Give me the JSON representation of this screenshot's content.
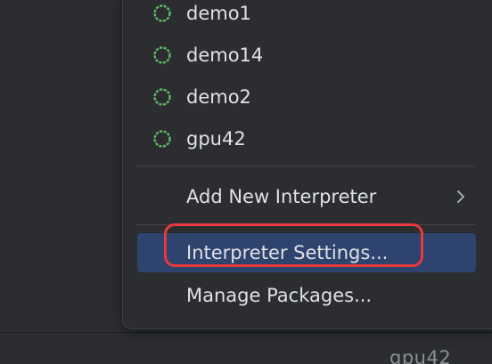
{
  "interpreters": [
    {
      "name": "demo1",
      "icon": "loading-spinner-icon"
    },
    {
      "name": "demo14",
      "icon": "loading-spinner-icon"
    },
    {
      "name": "demo2",
      "icon": "loading-spinner-icon"
    },
    {
      "name": "gpu42",
      "icon": "loading-spinner-icon"
    }
  ],
  "menu": {
    "add_new_interpreter": "Add New Interpreter",
    "interpreter_settings": "Interpreter Settings...",
    "manage_packages": "Manage Packages..."
  },
  "status_bar": {
    "interpreter": "gpu42"
  },
  "colors": {
    "background": "#2b2d30",
    "selection": "#2e436e",
    "spinner": "#5fb865",
    "highlight_ring": "#e8393b",
    "text": "#dfe1e5"
  }
}
